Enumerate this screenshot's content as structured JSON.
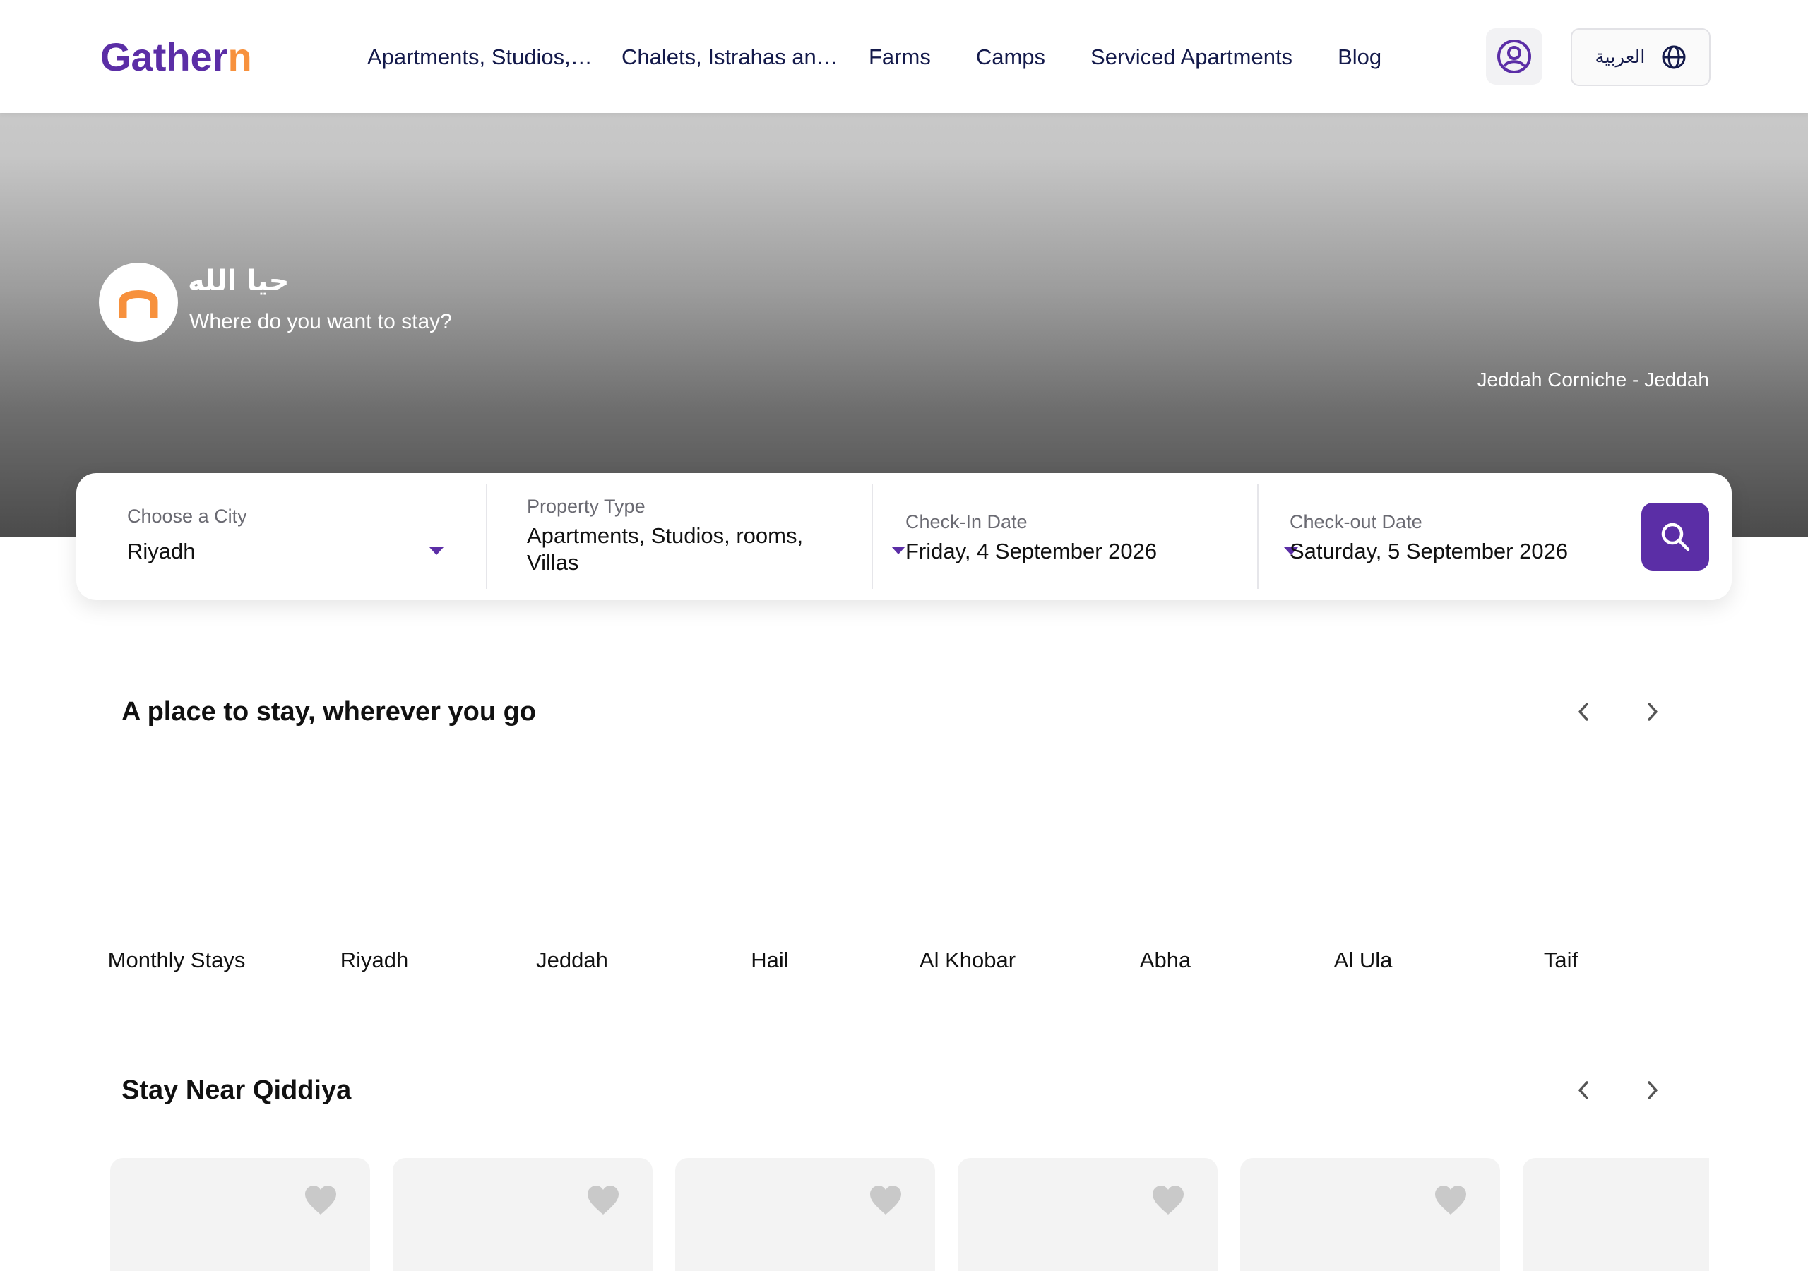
{
  "header": {
    "logo": {
      "main": "Gather",
      "accent": "n"
    },
    "nav": [
      {
        "label": "Apartments, Studios, ..."
      },
      {
        "label": "Chalets, Istrahas and ..."
      },
      {
        "label": "Farms"
      },
      {
        "label": "Camps"
      },
      {
        "label": "Serviced Apartments"
      },
      {
        "label": "Blog"
      }
    ],
    "language_label": "العربية",
    "icons": {
      "profile": "user-circle-icon",
      "language": "globe-icon"
    }
  },
  "hero": {
    "greeting_ar": "حيا الله",
    "subtitle": "Where do you want to stay?",
    "photo_caption": "Jeddah Corniche - Jeddah"
  },
  "search": {
    "city": {
      "label": "Choose a City",
      "value": "Riyadh"
    },
    "property_type": {
      "label": "Property Type",
      "value": "Apartments, Studios, rooms, Villas"
    },
    "check_in": {
      "label": "Check-In Date",
      "value": "Friday, 4 September 2026"
    },
    "check_out": {
      "label": "Check-out Date",
      "value": "Saturday, 5 September 2026"
    },
    "search_icon": "search-icon"
  },
  "section_places": {
    "title": "A place to stay, wherever you go",
    "cities": [
      "Monthly Stays",
      "Riyadh",
      "Jeddah",
      "Hail",
      "Al Khobar",
      "Abha",
      "Al Ula",
      "Taif"
    ]
  },
  "section_qiddiya": {
    "title": "Stay Near Qiddiya",
    "card_count_visible": 6
  },
  "colors": {
    "brand": "#5b2ea6",
    "accent": "#f7913d",
    "nav_text": "#141a4b"
  }
}
